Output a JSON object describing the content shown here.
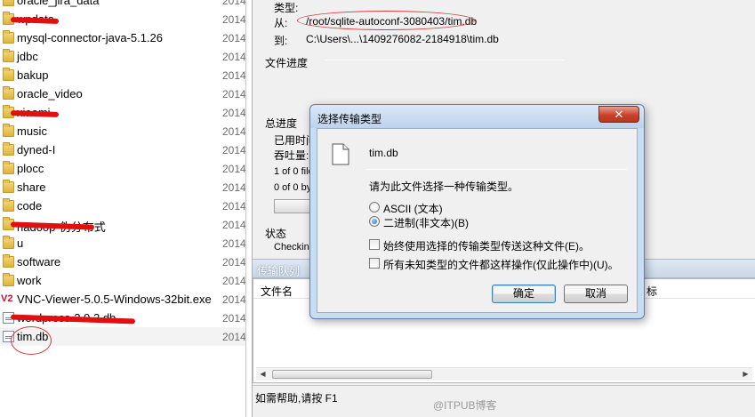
{
  "file_list": {
    "items": [
      {
        "name": "oracle_jira_data",
        "date": "2014",
        "type": "folder"
      },
      {
        "name": "wpdata",
        "date": "2014",
        "type": "folder",
        "redacted": true
      },
      {
        "name": "mysql-connector-java-5.1.26",
        "date": "2014",
        "type": "folder"
      },
      {
        "name": "jdbc",
        "date": "2014",
        "type": "folder"
      },
      {
        "name": "bakup",
        "date": "2014",
        "type": "folder"
      },
      {
        "name": "oracle_video",
        "date": "2014",
        "type": "folder"
      },
      {
        "name": "xiaomi",
        "date": "2014",
        "type": "folder",
        "redacted": true
      },
      {
        "name": "music",
        "date": "2014",
        "type": "folder"
      },
      {
        "name": "dyned-I",
        "date": "2014",
        "type": "folder"
      },
      {
        "name": "plocc",
        "date": "2014",
        "type": "folder"
      },
      {
        "name": "share",
        "date": "2014",
        "type": "folder"
      },
      {
        "name": "code",
        "date": "2014",
        "type": "folder"
      },
      {
        "name": "hadoop-伪分布式",
        "date": "2014",
        "type": "folder",
        "redacted": true
      },
      {
        "name": "u",
        "date": "2014",
        "type": "folder"
      },
      {
        "name": "software",
        "date": "2014",
        "type": "folder"
      },
      {
        "name": "work",
        "date": "2014",
        "type": "folder"
      },
      {
        "name": "VNC-Viewer-5.0.5-Windows-32bit.exe",
        "date": "2014",
        "type": "exe"
      },
      {
        "name": "wordpress-2.9.2.db",
        "date": "2014",
        "type": "file",
        "redacted": true
      },
      {
        "name": "tim.db",
        "date": "2014",
        "type": "file",
        "selected": true
      }
    ]
  },
  "transfer": {
    "type_label": "类型:",
    "from_label": "从:",
    "from_value": "/root/sqlite-autoconf-3080403/tim.db",
    "to_label": "到:",
    "to_value": "C:\\Users\\...\\1409276082-2184918\\tim.db",
    "file_progress_label": "文件进度",
    "total_progress_label": "总进度",
    "elapsed_label": "已用时间",
    "throughput_label": "吞吐量:",
    "files_count": "1 of 0 file",
    "bytes_count": "0 of 0 by",
    "status_label": "状态",
    "status_value": "Checking"
  },
  "queue": {
    "title": "传输队列",
    "col_filename": "文件名",
    "col_other": "标"
  },
  "status_bar": {
    "help_text": "如需帮助,请按 F1"
  },
  "watermark": "@ITPUB博客",
  "dialog": {
    "title": "选择传输类型",
    "close_glyph": "✕",
    "filename": "tim.db",
    "prompt": "请为此文件选择一种传输类型。",
    "option_ascii": "ASCII (文本)",
    "option_binary": "二进制(非文本)(B)",
    "selected_option": "binary",
    "check_always": "始终使用选择的传输类型传送这种文件(E)。",
    "check_unknown": "所有未知类型的文件都这样操作(仅此操作中)(U)。",
    "ok_label": "确定",
    "cancel_label": "取消"
  },
  "colors": {
    "annotation_red": "#e01010",
    "dialog_frame": "#c9dcf1",
    "close_button": "#c7432c"
  }
}
